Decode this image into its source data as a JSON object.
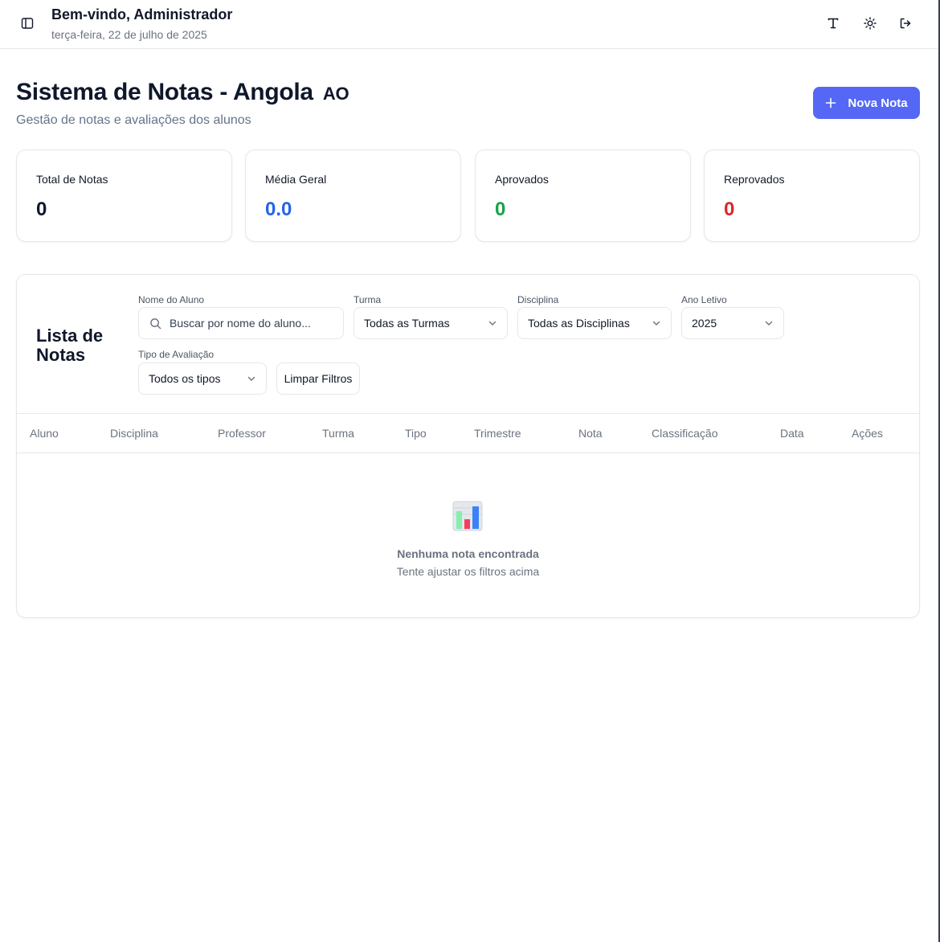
{
  "header": {
    "welcome": "Bem-vindo, Administrador",
    "date": "terça-feira, 22 de julho de 2025",
    "icons": [
      "sidebar-toggle-icon",
      "font-size-icon",
      "sun-icon",
      "logout-icon"
    ]
  },
  "page": {
    "title": "Sistema de Notas - Angola",
    "flag_code": "AO",
    "subtitle": "Gestão de notas e avaliações dos alunos",
    "new_button": "Nova Nota"
  },
  "stats": [
    {
      "label": "Total de Notas",
      "value": "0",
      "color": "#0f172a"
    },
    {
      "label": "Média Geral",
      "value": "0.0",
      "color": "#2563eb"
    },
    {
      "label": "Aprovados",
      "value": "0",
      "color": "#16a34a"
    },
    {
      "label": "Reprovados",
      "value": "0",
      "color": "#dc2626"
    }
  ],
  "list": {
    "title": "Lista de Notas",
    "filters": {
      "student_label": "Nome do Aluno",
      "student_placeholder": "Buscar por nome do aluno...",
      "class_label": "Turma",
      "class_value": "Todas as Turmas",
      "subject_label": "Disciplina",
      "subject_value": "Todas as Disciplinas",
      "year_label": "Ano Letivo",
      "year_value": "2025",
      "type_label": "Tipo de Avaliação",
      "type_value": "Todos os tipos",
      "clear_button": "Limpar Filtros"
    },
    "columns": [
      "Aluno",
      "Disciplina",
      "Professor",
      "Turma",
      "Tipo",
      "Trimestre",
      "Nota",
      "Classificação",
      "Data",
      "Ações"
    ],
    "empty_title": "Nenhuma nota encontrada",
    "empty_subtitle": "Tente ajustar os filtros acima"
  },
  "colors": {
    "accent": "#5468f5",
    "border": "#e5e7eb",
    "muted_text": "#6b7280"
  }
}
